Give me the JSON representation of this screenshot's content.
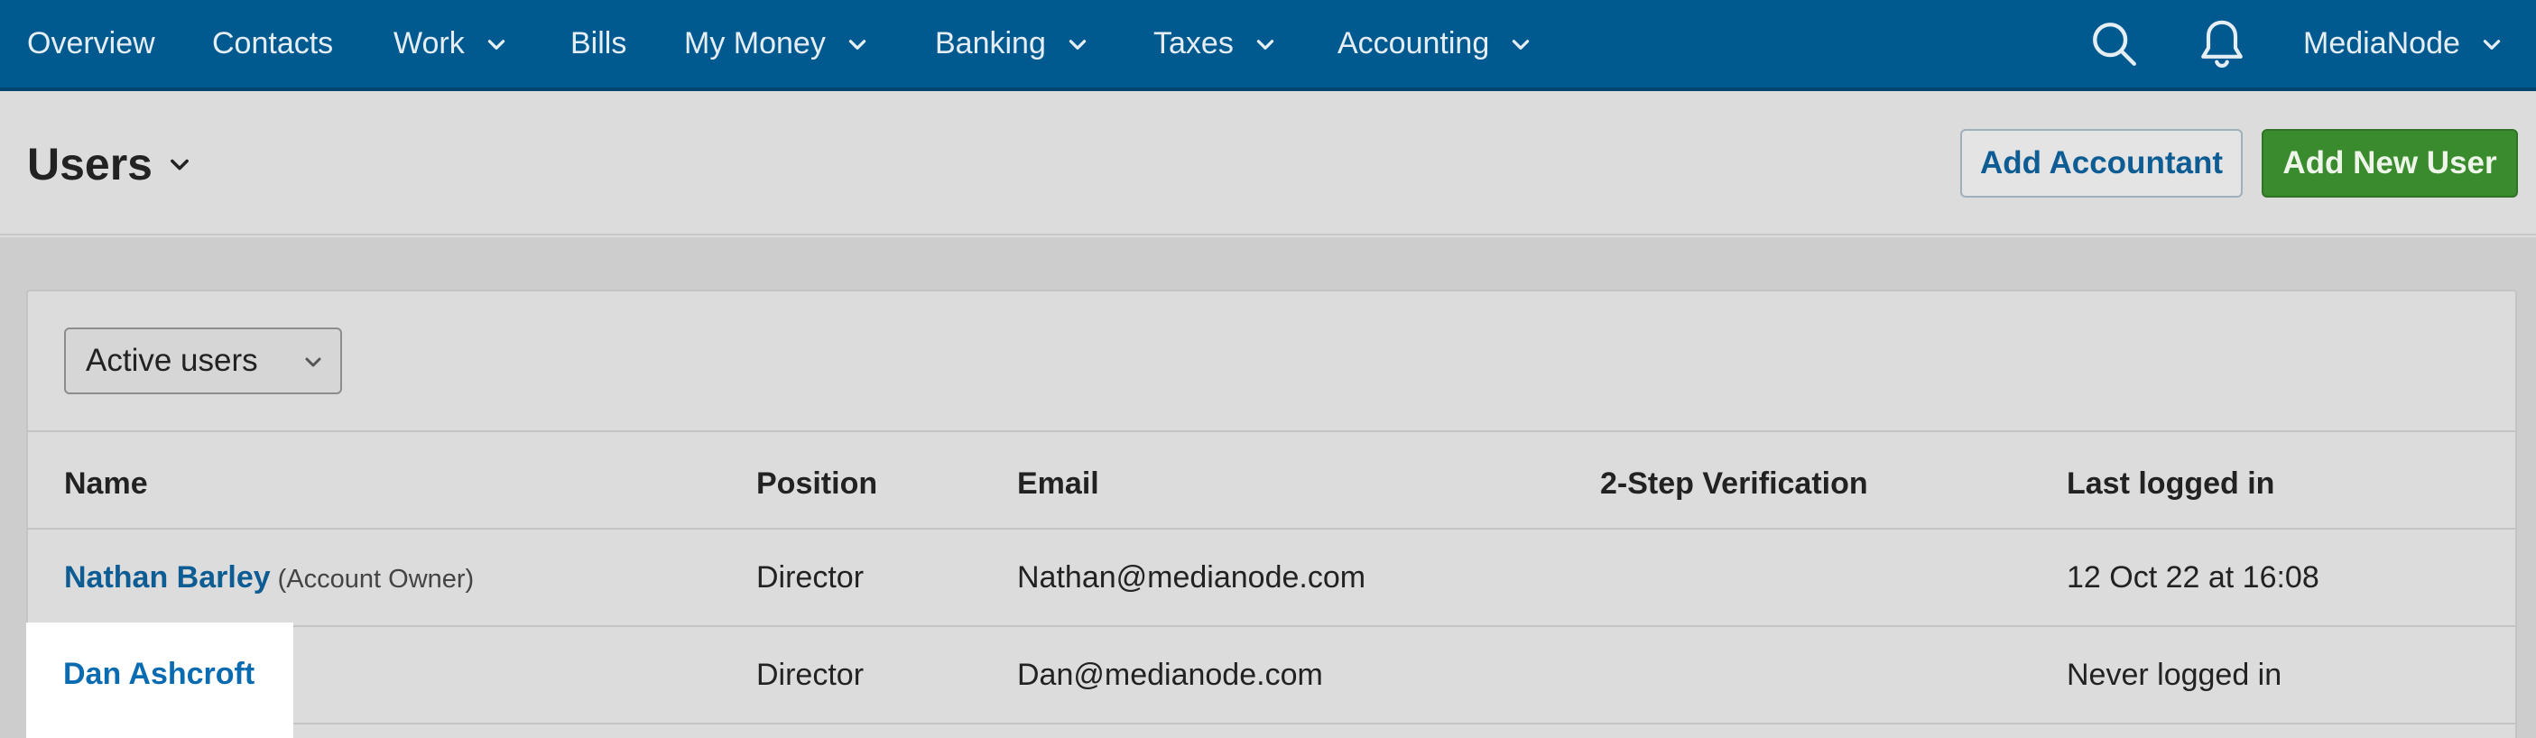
{
  "nav": {
    "items": [
      {
        "label": "Overview",
        "dropdown": false
      },
      {
        "label": "Contacts",
        "dropdown": false
      },
      {
        "label": "Work",
        "dropdown": true
      },
      {
        "label": "Bills",
        "dropdown": false
      },
      {
        "label": "My Money",
        "dropdown": true
      },
      {
        "label": "Banking",
        "dropdown": true
      },
      {
        "label": "Taxes",
        "dropdown": true
      },
      {
        "label": "Accounting",
        "dropdown": true
      }
    ],
    "account_label": "MediaNode",
    "icons": [
      "search-icon",
      "bell-icon"
    ]
  },
  "header": {
    "title": "Users",
    "add_accountant_label": "Add Accountant",
    "add_user_label": "Add New User"
  },
  "filter": {
    "selected": "Active users"
  },
  "table": {
    "columns": [
      "Name",
      "Position",
      "Email",
      "2-Step Verification",
      "Last logged in"
    ],
    "rows": [
      {
        "name": "Nathan Barley",
        "tag": "(Account Owner)",
        "position": "Director",
        "email": "Nathan@medianode.com",
        "two_step": "",
        "last_login": "12 Oct 22 at 16:08"
      },
      {
        "name": "Dan Ashcroft",
        "tag": "",
        "position": "Director",
        "email": "Dan@medianode.com",
        "two_step": "",
        "last_login": "Never logged in"
      }
    ]
  },
  "colors": {
    "nav_bg": "#005a8f",
    "link": "#0e5c94",
    "primary_button": "#3a8a2e",
    "highlight": "#ffffff"
  }
}
